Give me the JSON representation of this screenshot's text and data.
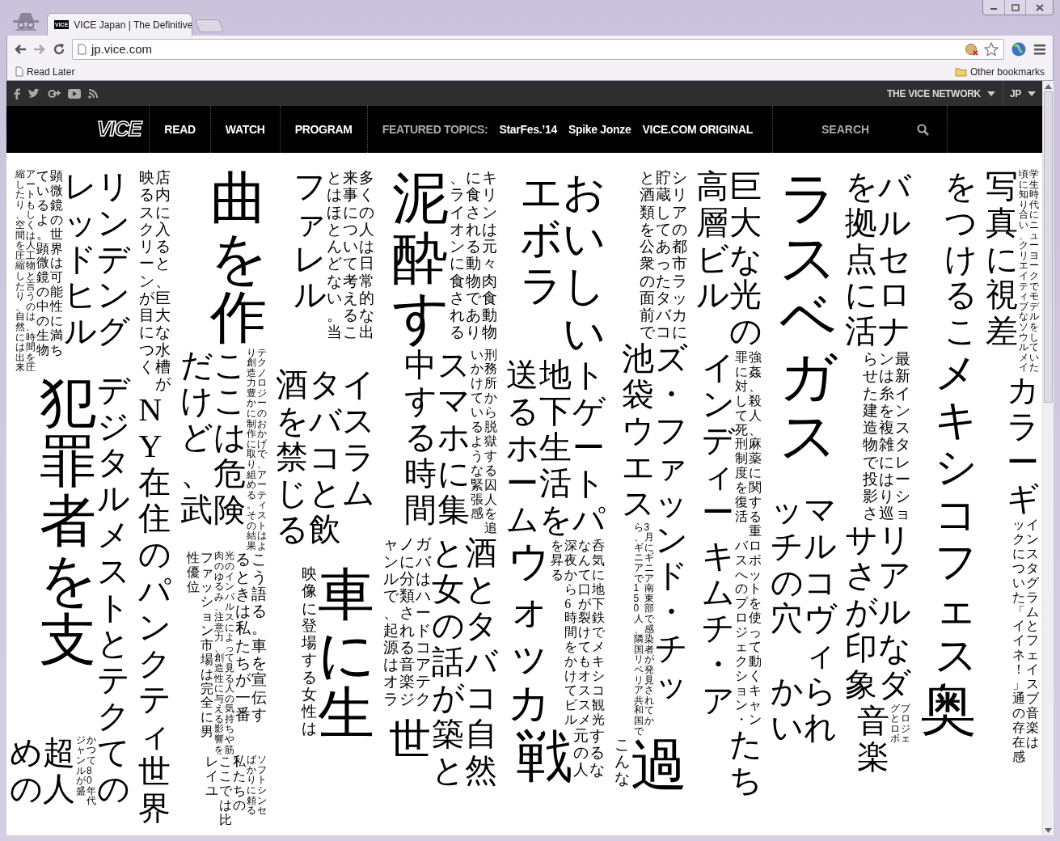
{
  "browser": {
    "tab": {
      "title": "VICE Japan | The Definitive",
      "favicon": "VICE"
    },
    "url": "jp.vice.com",
    "bookmarks": [
      "Read Later"
    ],
    "other_bookmarks": "Other bookmarks"
  },
  "site": {
    "top_bar": {
      "network": "THE VICE NETWORK",
      "language": "JP"
    },
    "logo": "VICE",
    "menu": [
      "READ",
      "WATCH",
      "PROGRAM"
    ],
    "featured_label": "FEATURED TOPICS:",
    "featured": [
      "StarFes.’14",
      "Spike Jonze",
      "VICE.COM ORIGINAL"
    ],
    "search": {
      "placeholder": "SEARCH"
    }
  },
  "strips": [
    {
      "blocks": [
        {
          "columns": [
            {
              "kind": "tiny",
              "text": "縮したり、空間を圧縮したり、自然には出来"
            },
            {
              "kind": "tiny",
              "text": "アートもしくは人工物と言うのは、時間を圧"
            },
            {
              "kind": "caption",
              "text": "ているよ。顕微鏡の中の生物"
            },
            {
              "kind": "caption",
              "text": "顕微鏡の世界は可能性に満ち"
            },
            {
              "kind": "large",
              "text": "レッドヒル"
            },
            {
              "kind": "large",
              "text": "リンデング"
            }
          ]
        },
        {
          "columns": [
            {
              "kind": "huge",
              "text": "犯罪者を支"
            },
            {
              "kind": "large",
              "text": "デジタルメストとテク"
            }
          ]
        },
        {
          "columns": [
            {
              "kind": "large",
              "text": "めの"
            },
            {
              "kind": "large",
              "text": "超人"
            },
            {
              "kind": "tiny",
              "text": "ジャンルが盛"
            },
            {
              "kind": "tiny",
              "text": "かつて80年代"
            },
            {
              "kind": "large",
              "text": "ての"
            }
          ]
        }
      ]
    },
    {
      "blocks": [
        {
          "columns": [
            {
              "kind": "small",
              "text": "映るスクリーンが目につく"
            },
            {
              "kind": "small",
              "text": "店内に入ると、巨大な水槽が"
            }
          ]
        },
        {
          "columns": [
            {
              "kind": "large",
              "text": "NY在住の"
            }
          ]
        },
        {
          "columns": [
            {
              "kind": "large",
              "text": "パンクティ"
            }
          ]
        },
        {
          "columns": [
            {
              "kind": "large",
              "text": "世界"
            }
          ]
        }
      ]
    },
    {
      "blocks": [
        {
          "columns": [
            {
              "kind": "huge",
              "text": "曲を作"
            }
          ]
        },
        {
          "columns": [
            {
              "kind": "large",
              "text": "だけど、武"
            },
            {
              "kind": "large",
              "text": "ここは危険"
            },
            {
              "kind": "tiny",
              "text": "り創造力豊かに制作に取り組める。その結果"
            },
            {
              "kind": "tiny",
              "text": "テクノロジーのおかげで、アーティストはよ"
            }
          ]
        },
        {
          "columns": [
            {
              "kind": "caption",
              "text": "性優位"
            },
            {
              "kind": "caption",
              "text": "ファッション市場は完全に男"
            },
            {
              "kind": "tiny",
              "text": "肉のゆるみ、注意力、創造性に与える影響を"
            },
            {
              "kind": "tiny",
              "text": "光のインパルスによって見る人の気持ちや筋"
            },
            {
              "kind": "small",
              "text": "るときは私たちが一番"
            },
            {
              "kind": "small",
              "text": "こう語る。車を宣伝す"
            }
          ]
        },
        {
          "columns": [
            {
              "kind": "caption",
              "text": "レイユ"
            },
            {
              "kind": "caption",
              "text": "ここでは比"
            },
            {
              "kind": "caption",
              "text": "私たちの"
            },
            {
              "kind": "tiny",
              "text": "ばかりに頼る"
            },
            {
              "kind": "tiny",
              "text": "ソフトシンセ"
            }
          ]
        }
      ]
    },
    {
      "blocks": [
        {
          "columns": [
            {
              "kind": "large",
              "text": "ファレル"
            },
            {
              "kind": "small",
              "text": "とはほとんどない。当"
            },
            {
              "kind": "small",
              "text": "来事について考えるこ"
            },
            {
              "kind": "small",
              "text": "多くの人は日常的な出"
            }
          ]
        },
        {
          "columns": [
            {
              "kind": "large",
              "text": "酒を禁じる"
            },
            {
              "kind": "large",
              "text": "タバコと飲"
            },
            {
              "kind": "large",
              "text": "イスラム"
            }
          ]
        },
        {
          "columns": [
            {
              "kind": "small",
              "text": "映像に登場する女性は"
            },
            {
              "kind": "huge",
              "text": "車に生"
            }
          ]
        }
      ]
    },
    {
      "blocks": [
        {
          "columns": [
            {
              "kind": "huge",
              "text": "泥酔す"
            },
            {
              "kind": "small",
              "text": "、ライオンに食される"
            },
            {
              "kind": "small",
              "text": "に食される動物であり"
            },
            {
              "kind": "small",
              "text": "キリンは元々肉食動物"
            }
          ]
        },
        {
          "columns": [
            {
              "kind": "large",
              "text": "中する時間"
            },
            {
              "kind": "large",
              "text": "スマホに集"
            },
            {
              "kind": "caption",
              "text": "いかけているような緊張感"
            },
            {
              "kind": "caption",
              "text": "刑務所から脱獄する囚人を追"
            }
          ]
        },
        {
          "columns": [
            {
              "kind": "small",
              "text": "ャンルで、起源はオラ"
            },
            {
              "kind": "small",
              "text": "ノに分類される音楽ジ"
            },
            {
              "kind": "small",
              "text": "ガバはハードコアテク"
            },
            {
              "kind": "large",
              "text": "と女の話が"
            },
            {
              "kind": "large",
              "text": "酒とタバコ"
            }
          ]
        },
        {
          "columns": [
            {
              "kind": "big",
              "text": "世"
            },
            {
              "kind": "large",
              "text": "築と"
            },
            {
              "kind": "large",
              "text": "自然"
            }
          ]
        }
      ]
    },
    {
      "blocks": [
        {
          "columns": [
            {
              "kind": "big",
              "text": "エボラ"
            },
            {
              "kind": "big",
              "text": "おいしい"
            }
          ]
        },
        {
          "columns": [
            {
              "kind": "large",
              "text": "送るホーム"
            },
            {
              "kind": "large",
              "text": "地下生活を"
            },
            {
              "kind": "large",
              "text": "トゲートパ"
            }
          ]
        },
        {
          "columns": [
            {
              "kind": "big",
              "text": "ウォッカ"
            },
            {
              "kind": "caption",
              "text": "を昇る"
            },
            {
              "kind": "caption",
              "text": "深夜から6時間をかけてビル"
            },
            {
              "kind": "caption",
              "text": "なんて口が裂けてもオススメ"
            },
            {
              "kind": "caption",
              "text": "呑気に地下鉄でメキシコ観光"
            }
          ]
        },
        {
          "columns": [
            {
              "kind": "huge",
              "text": "戦"
            },
            {
              "kind": "small",
              "text": "元の人"
            },
            {
              "kind": "small",
              "text": "するな"
            }
          ]
        }
      ]
    },
    {
      "blocks": [
        {
          "columns": [
            {
              "kind": "small",
              "text": "と酒類を公衆の面前で"
            },
            {
              "kind": "small",
              "text": "貯蔵してあったタバコ"
            },
            {
              "kind": "small",
              "text": "シリアの都市ラッカに"
            }
          ]
        },
        {
          "columns": [
            {
              "kind": "large",
              "text": "池袋ウエス"
            },
            {
              "kind": "large",
              "text": "ズ・ファッ"
            }
          ]
        },
        {
          "columns": [
            {
              "kind": "tiny",
              "text": "ら、ギニアで150人、隣国リベリア共和国で"
            },
            {
              "kind": "tiny",
              "text": "3月にギニア南東部で感染者が発見されてか"
            },
            {
              "kind": "large",
              "text": "ンド・チッ"
            }
          ]
        },
        {
          "columns": [
            {
              "kind": "small",
              "text": "こんな"
            },
            {
              "kind": "huge",
              "text": "過"
            }
          ]
        }
      ]
    },
    {
      "blocks": [
        {
          "columns": [
            {
              "kind": "large",
              "text": "高層ビル"
            },
            {
              "kind": "large",
              "text": "巨大な光の"
            }
          ]
        },
        {
          "columns": [
            {
              "kind": "large",
              "text": "インディー"
            },
            {
              "kind": "caption",
              "text": "罪に対して死刑制度を復活"
            },
            {
              "kind": "caption",
              "text": "強姦、殺人、麻薬に関する重"
            }
          ]
        },
        {
          "columns": [
            {
              "kind": "large",
              "text": "キムチ・ア"
            },
            {
              "kind": "caption",
              "text": "バスへのプロジェクション・"
            },
            {
              "kind": "caption",
              "text": "ロボットを使って動くキャン"
            }
          ]
        },
        {
          "columns": [
            {
              "kind": "large",
              "text": "たち"
            }
          ]
        }
      ]
    },
    {
      "blocks": [
        {
          "columns": [
            {
              "kind": "huge",
              "text": "ラスベガス"
            }
          ]
        },
        {
          "columns": [
            {
              "kind": "large",
              "text": "ッチの穴"
            },
            {
              "kind": "large",
              "text": "マルコヴィ"
            }
          ]
        },
        {
          "columns": [
            {
              "kind": "large",
              "text": "かい"
            },
            {
              "kind": "large",
              "text": "られ"
            }
          ]
        }
      ]
    },
    {
      "blocks": [
        {
          "columns": [
            {
              "kind": "large",
              "text": "を拠点に活"
            },
            {
              "kind": "large",
              "text": "バルセロナ"
            }
          ]
        },
        {
          "columns": [
            {
              "kind": "small",
              "text": "らせた建造物で投影さ"
            },
            {
              "kind": "small",
              "text": "ンは糸を複雑にはり巡"
            },
            {
              "kind": "small",
              "text": "最新インスタレーショ"
            }
          ]
        },
        {
          "columns": [
            {
              "kind": "large",
              "text": "サさが印象"
            },
            {
              "kind": "large",
              "text": "リアルなダ"
            }
          ]
        },
        {
          "columns": [
            {
              "kind": "large",
              "text": "音楽"
            },
            {
              "kind": "tiny",
              "text": "グとロボ"
            },
            {
              "kind": "tiny",
              "text": "プロジェ"
            }
          ]
        }
      ]
    },
    {
      "blocks": [
        {
          "columns": [
            {
              "kind": "large",
              "text": "をつけるこ"
            }
          ]
        },
        {
          "columns": [
            {
              "kind": "big",
              "text": "メキシコフェス"
            }
          ]
        },
        {
          "columns": [
            {
              "kind": "huge",
              "text": "奥"
            }
          ]
        }
      ]
    },
    {
      "blocks": [
        {
          "columns": [
            {
              "kind": "large",
              "text": "写真に視差"
            },
            {
              "kind": "tiny",
              "text": "頃に知り合い、クリエイティブなソウルメイ"
            },
            {
              "kind": "tiny",
              "text": "学生時代にニューヨークでモデルをしていた"
            }
          ]
        },
        {
          "columns": [
            {
              "kind": "large",
              "text": "カラーギ"
            }
          ]
        },
        {
          "columns": [
            {
              "kind": "caption",
              "text": "ックについた「イイネ！」通"
            },
            {
              "kind": "caption",
              "text": "インスタグラムとフェイスブ"
            }
          ]
        },
        {
          "columns": [
            {
              "kind": "caption",
              "text": "の存在感"
            },
            {
              "kind": "caption",
              "text": "音楽は"
            }
          ]
        }
      ]
    }
  ]
}
